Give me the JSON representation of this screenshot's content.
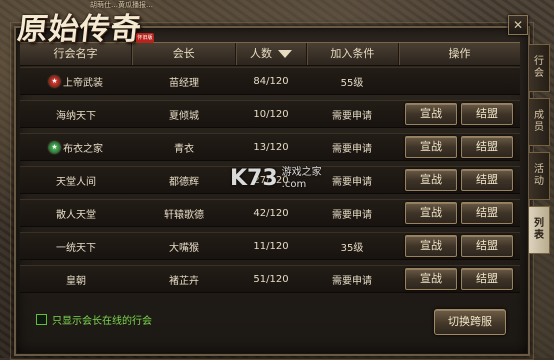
{
  "game": {
    "title": "原始传奇",
    "stamp": "怀旧版",
    "top_strip_text": "胡萌仕…黄瓜播报…"
  },
  "window": {
    "close_label": "✕"
  },
  "table": {
    "columns": {
      "name": "行会名字",
      "leader": "会长",
      "count": "人数",
      "condition": "加入条件",
      "ops": "操作"
    },
    "rows": [
      {
        "name": "上帝武装",
        "badge": "red",
        "leader": "苗经理",
        "count": "84/120",
        "condition": "55级",
        "show_ops": false
      },
      {
        "name": "海纳天下",
        "badge": "",
        "leader": "夏倾城",
        "count": "10/120",
        "condition": "需要申请",
        "show_ops": true
      },
      {
        "name": "布衣之家",
        "badge": "green",
        "leader": "青衣",
        "count": "13/120",
        "condition": "需要申请",
        "show_ops": true
      },
      {
        "name": "天堂人间",
        "badge": "",
        "leader": "都德辉",
        "count": "27/120",
        "condition": "需要申请",
        "show_ops": true
      },
      {
        "name": "散人天堂",
        "badge": "",
        "leader": "轩辕歌德",
        "count": "42/120",
        "condition": "需要申请",
        "show_ops": true
      },
      {
        "name": "一统天下",
        "badge": "",
        "leader": "大嘴猴",
        "count": "11/120",
        "condition": "35级",
        "show_ops": true
      },
      {
        "name": "皇朝",
        "badge": "",
        "leader": "褚芷卉",
        "count": "51/120",
        "condition": "需要申请",
        "show_ops": true
      }
    ],
    "btn_war": "宣战",
    "btn_ally": "结盟"
  },
  "footer": {
    "checkbox_label": "只显示会长在线的行会",
    "checkbox_checked": false,
    "switch_button": "切换跨服"
  },
  "side_tabs": [
    {
      "label": "行会",
      "active": false
    },
    {
      "label": "成员",
      "active": false
    },
    {
      "label": "活动",
      "active": false
    },
    {
      "label": "列表",
      "active": true
    }
  ],
  "watermark": {
    "big": "K73",
    "line1": "游戏之家",
    "line2": ".com"
  },
  "colors": {
    "accent_text": "#e6dcc6",
    "filter_green": "#7cd84d",
    "badge_red": "#c0281c",
    "badge_green": "#3a9c46"
  }
}
